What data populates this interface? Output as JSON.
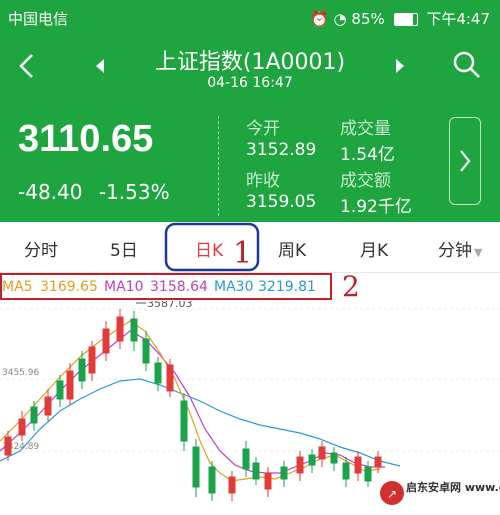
{
  "status_bar": {
    "carrier": "中国电信",
    "battery": "85%",
    "time": "下午4:47"
  },
  "header": {
    "title": "上证指数(1A0001)",
    "timestamp": "04-16 16:47"
  },
  "quote": {
    "price": "3110.65",
    "change": "-48.40",
    "change_pct": "-1.53%",
    "open_label": "今开",
    "open_value": "3152.89",
    "prev_close_label": "昨收",
    "prev_close_value": "3159.05",
    "volume_label": "成交量",
    "volume_value": "1.54亿",
    "turnover_label": "成交额",
    "turnover_value": "1.92千亿"
  },
  "tabs": [
    "分时",
    "5日",
    "日K",
    "周K",
    "月K",
    "分钟"
  ],
  "active_tab": "日K",
  "annotations": {
    "tab_marker": "1",
    "indicator_marker": "2"
  },
  "indicators": {
    "ma5_label": "MA5",
    "ma5_value": "3169.65",
    "ma10_label": "MA10",
    "ma10_value": "3158.64",
    "ma30_label": "MA30",
    "ma30_value": "3219.81"
  },
  "chart_axis": {
    "high_label": "3587.03",
    "y_mid": "3455.96",
    "y_low": "3324.89"
  },
  "colors": {
    "header_green": "#1fa53f",
    "up": "#e23b3b",
    "down": "#1aa34a",
    "ma5": "#e0a020",
    "ma10": "#c040c0",
    "ma30": "#2a9ad0",
    "annotation": "#c0202a",
    "box_blue": "#1a3a9a"
  },
  "watermark": "启东安卓网 www.qdltdq.com"
}
